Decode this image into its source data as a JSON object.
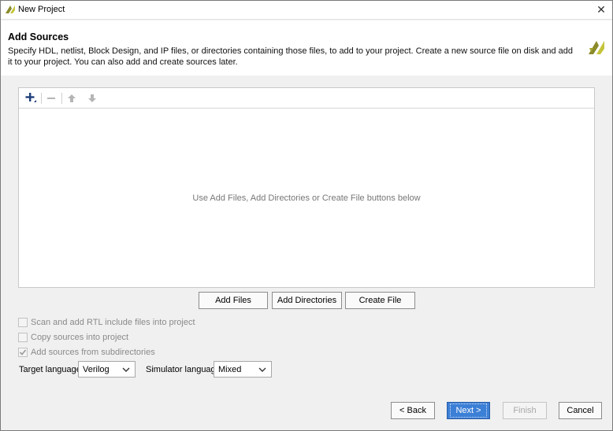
{
  "window": {
    "title": "New Project"
  },
  "header": {
    "title": "Add Sources",
    "description": "Specify HDL, netlist, Block Design, and IP files, or directories containing those files, to add to your project. Create a new source file on disk and add it to your project. You can also add and create sources later."
  },
  "sources": {
    "empty_message": "Use Add Files, Add Directories or Create File buttons below"
  },
  "actions": {
    "add_files": "Add Files",
    "add_directories": "Add Directories",
    "create_file": "Create File"
  },
  "options": {
    "scan_rtl": {
      "label": "Scan and add RTL include files into project",
      "checked": false
    },
    "copy_sources": {
      "label": "Copy sources into project",
      "checked": false
    },
    "add_subdirs": {
      "label": "Add sources from subdirectories",
      "checked": true
    }
  },
  "language": {
    "target_label": "Target language:",
    "target_value": "Verilog",
    "simulator_label": "Simulator language:",
    "simulator_value": "Mixed"
  },
  "footer": {
    "back": "< Back",
    "next": "Next >",
    "finish": "Finish",
    "cancel": "Cancel"
  },
  "colors": {
    "primary_button": "#3c7fd6",
    "logo_dark": "#8a8a2a",
    "logo_light": "#c4c43a"
  }
}
